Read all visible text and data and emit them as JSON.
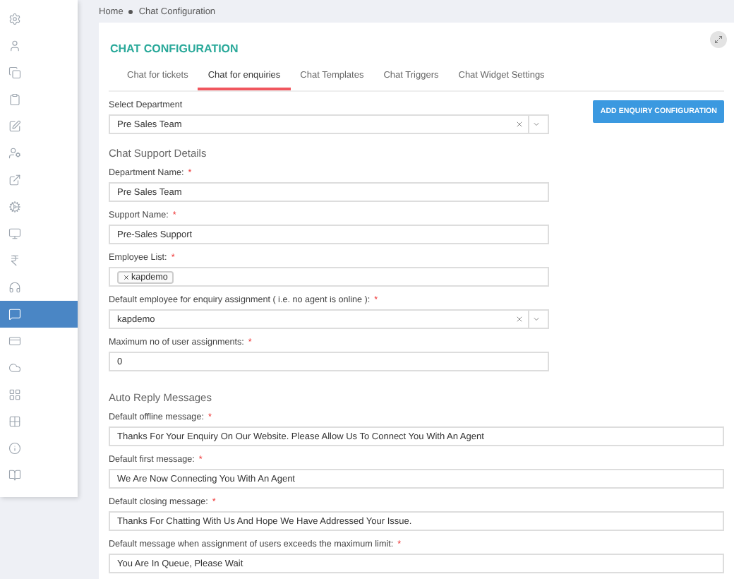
{
  "breadcrumb": [
    "Home",
    "Chat Configuration"
  ],
  "sidebar": {
    "items": [
      {
        "selected": false
      },
      {
        "selected": false
      },
      {
        "selected": false
      },
      {
        "selected": false
      },
      {
        "selected": false
      },
      {
        "selected": false
      },
      {
        "selected": false
      },
      {
        "selected": false
      },
      {
        "selected": false
      },
      {
        "selected": false
      },
      {
        "selected": false
      },
      {
        "selected": true
      },
      {
        "selected": false
      },
      {
        "selected": false
      },
      {
        "selected": false
      },
      {
        "selected": false
      },
      {
        "selected": false
      },
      {
        "selected": false
      }
    ]
  },
  "card": {
    "title": "CHAT CONFIGURATION",
    "tabs": [
      {
        "label": "Chat for tickets",
        "selected": false
      },
      {
        "label": "Chat for enquiries",
        "selected": true
      },
      {
        "label": "Chat Templates",
        "selected": false
      },
      {
        "label": "Chat Triggers",
        "selected": false
      },
      {
        "label": "Chat Widget Settings",
        "selected": false
      }
    ],
    "department": {
      "label": "Select Department",
      "value": "Pre Sales Team"
    },
    "add_button": "ADD ENQUIRY CONFIGURATION",
    "support_section": {
      "heading": "Chat Support Details",
      "fields": [
        {
          "kind": "text",
          "label": "Department Name:",
          "required_mark": "*",
          "value": "Pre Sales Team"
        },
        {
          "kind": "text",
          "label": "Support Name:",
          "required_mark": "*",
          "value": "Pre-Sales Support"
        },
        {
          "kind": "tags",
          "label": "Employee List:",
          "required_mark": "*",
          "tags": [
            "kapdemo"
          ]
        },
        {
          "kind": "select",
          "label": "Default employee for enquiry assignment ( i.e. no agent is online ):",
          "required_mark": "*",
          "value": "kapdemo"
        },
        {
          "kind": "text",
          "label": "Maximum no of user assignments:",
          "required_mark": "*",
          "value": "0"
        }
      ]
    },
    "auto_reply_section": {
      "heading": "Auto Reply Messages",
      "fields": [
        {
          "kind": "text",
          "label": "Default offline message:",
          "required_mark": "*",
          "value": "Thanks For Your Enquiry On Our Website. Please Allow Us To Connect You With An Agent"
        },
        {
          "kind": "text",
          "label": "Default first message:",
          "required_mark": "*",
          "value": "We Are Now Connecting You With An Agent"
        },
        {
          "kind": "text",
          "label": "Default closing message:",
          "required_mark": "*",
          "value": "Thanks For Chatting With Us And Hope We Have Addressed Your Issue."
        },
        {
          "kind": "text",
          "label": "Default message when assignment of users exceeds the maximum limit:",
          "required_mark": "*",
          "value": "You Are In Queue, Please Wait"
        }
      ]
    }
  }
}
